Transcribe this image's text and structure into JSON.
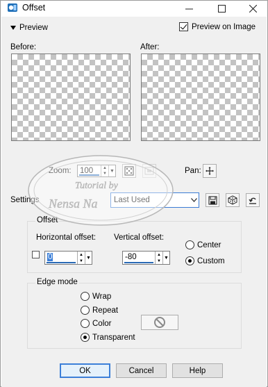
{
  "window": {
    "title": "Offset",
    "icons": {
      "app": "psp-app-icon",
      "minimize": "minimize-icon",
      "maximize": "maximize-icon",
      "close": "close-icon"
    }
  },
  "preview": {
    "toggle_label": "Preview",
    "preview_on_image_label": "Preview on Image",
    "preview_on_image_checked": true,
    "before_label": "Before:",
    "after_label": "After:"
  },
  "zoom": {
    "label": "Zoom:",
    "value": "100",
    "pan_label": "Pan:"
  },
  "settings": {
    "label": "Settings",
    "selected": "Last Used"
  },
  "offset": {
    "group_title": "Offset",
    "horizontal_label": "Horizontal offset:",
    "horizontal_value": "0",
    "vertical_label": "Vertical offset:",
    "vertical_value": "-80",
    "link_checked": false,
    "center_label": "Center",
    "custom_label": "Custom",
    "selected": "Custom"
  },
  "edge_mode": {
    "group_title": "Edge mode",
    "options": [
      "Wrap",
      "Repeat",
      "Color",
      "Transparent"
    ],
    "selected": "Transparent"
  },
  "buttons": {
    "ok": "OK",
    "cancel": "Cancel",
    "help": "Help"
  },
  "watermark": {
    "line1": "Tutorial by",
    "line2": "Nensa Na"
  },
  "colors": {
    "accent": "#3c7fd8",
    "dialog_bg": "#f0f0f0",
    "checker_gray": "#c3c3c3"
  }
}
